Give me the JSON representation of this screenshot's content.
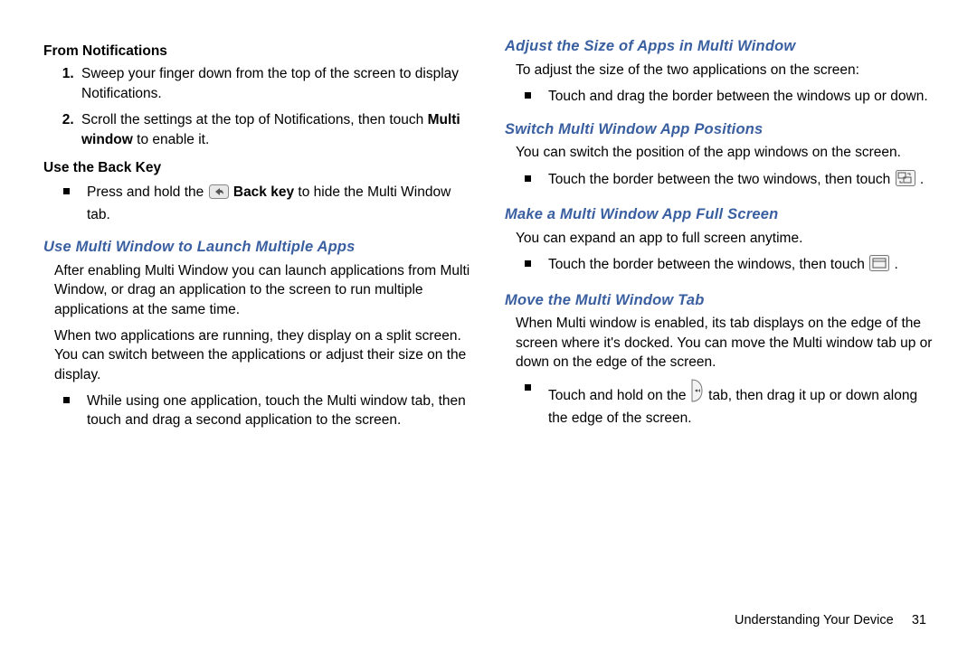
{
  "left": {
    "h_from_notif": "From Notifications",
    "notif_steps": [
      "Sweep your finger down from the top of the screen to display Notifications.",
      "Scroll the settings at the top of Notifications, then touch "
    ],
    "notif_step2_bold": "Multi window",
    "notif_step2_tail": " to enable it.",
    "h_back_key": "Use the Back Key",
    "back_key_lead": "Press and hold the ",
    "back_key_bold": " Back key",
    "back_key_tail": " to hide the Multi Window tab.",
    "h_launch": "Use Multi Window to Launch Multiple Apps",
    "launch_p1": "After enabling Multi Window you can launch applications from Multi Window, or drag an application to the screen to run multiple applications at the same time.",
    "launch_p2": "When two applications are running, they display on a split screen. You can switch between the applications or adjust their size on the display.",
    "launch_bullet": "While using one application, touch the Multi window tab, then touch and drag a second application to the screen."
  },
  "right": {
    "h_adjust": "Adjust the Size of Apps in Multi Window",
    "adjust_p": "To adjust the size of the two applications on the screen:",
    "adjust_bullet": "Touch and drag the border between the windows up or down.",
    "h_switch": "Switch Multi Window App Positions",
    "switch_p": "You can switch the position of the app windows on the screen.",
    "switch_bullet_lead": "Touch the border between the two windows, then touch ",
    "switch_bullet_tail": " .",
    "h_full": "Make a Multi Window App Full Screen",
    "full_p": "You can expand an app to full screen anytime.",
    "full_bullet_lead": "Touch the border between the windows, then touch ",
    "full_bullet_tail": " .",
    "h_move": "Move the Multi Window Tab",
    "move_p": "When Multi window is enabled, its tab displays on the edge of the screen where it's docked. You can move the Multi window tab up or down on the edge of the screen.",
    "move_bullet_lead": "Touch and hold on the ",
    "move_bullet_tail": " tab, then drag it up or down along the edge of the screen."
  },
  "footer": {
    "section": "Understanding Your Device",
    "page": "31"
  }
}
